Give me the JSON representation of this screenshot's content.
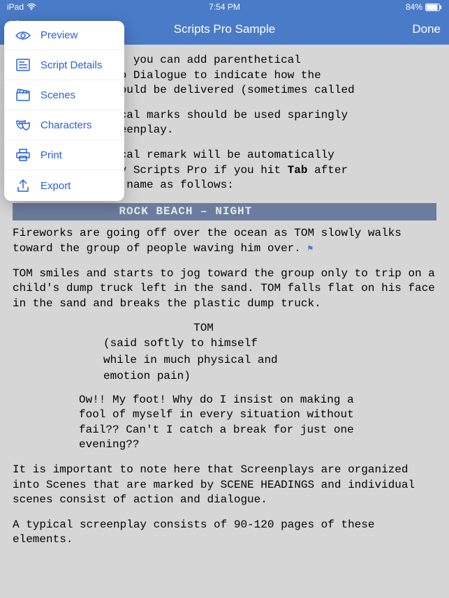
{
  "status": {
    "device": "iPad",
    "time": "7:54 PM",
    "battery": "84%"
  },
  "nav": {
    "title": "Scripts Pro Sample",
    "done": "Done"
  },
  "menu": {
    "items": [
      {
        "label": "Preview"
      },
      {
        "label": "Script Details"
      },
      {
        "label": "Scenes"
      },
      {
        "label": "Characters"
      },
      {
        "label": "Print"
      },
      {
        "label": "Export"
      }
    ]
  },
  "script": {
    "p1a": ", you can add parenthetical",
    "p1b": "o Dialogue to indicate how the",
    "p1c": "ould be delivered (sometimes called",
    "p2a": "cal marks should be used sparingly",
    "p2b": "eenplay.",
    "p3a": "cal remark will be automatically",
    "p3b": "y Scripts Pro if you hit ",
    "p3bold": "Tab",
    "p3c": " after",
    "p3d": " name as follows:",
    "scene": "ROCK BEACH – NIGHT",
    "action1": "Fireworks are going off over the ocean as TOM slowly walks toward the group of people waving him over.",
    "action2": "TOM smiles and starts to jog toward the group only to trip on a child's dump truck left in the sand. TOM falls flat on his face in the sand and breaks the plastic dump truck.",
    "char": "TOM",
    "paren1": "(said softly to himself",
    "paren2": " while in much physical and",
    "paren3": " emotion pain)",
    "dialogue": "Ow!! My foot! Why do I insist on making a fool of myself in every situation without fail?? Can't I catch a break for just one evening??",
    "note1": "It is important to note here that Screenplays are organized into Scenes that are marked by SCENE HEADINGS and individual scenes consist of action and dialogue.",
    "note2": "A typical screenplay consists of 90-120 pages of these elements."
  }
}
